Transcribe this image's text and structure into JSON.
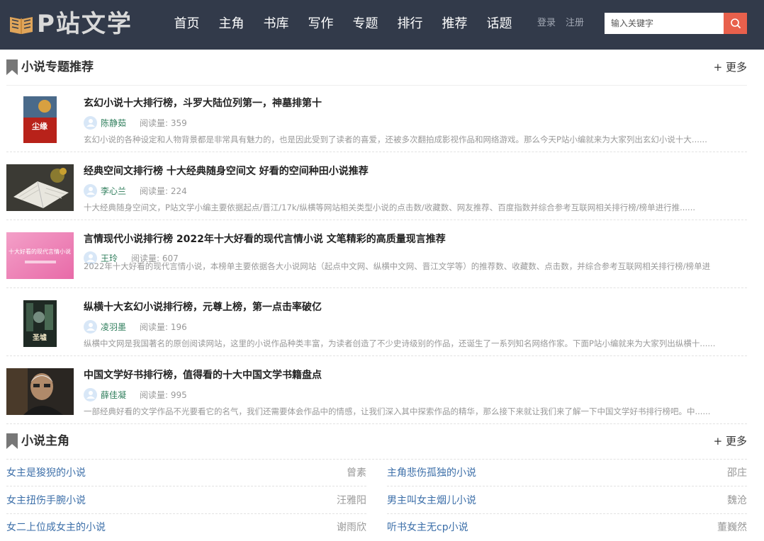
{
  "header": {
    "logo_text": "P站文学",
    "nav": [
      "首页",
      "主角",
      "书库",
      "写作",
      "专题",
      "排行",
      "推荐",
      "话题"
    ],
    "login": "登录",
    "register": "注册",
    "search_placeholder": "输入关键字"
  },
  "topics": {
    "heading": "小说专题推荐",
    "more": "+ 更多",
    "articles": [
      {
        "title": "玄幻小说十大排行榜，斗罗大陆位列第一，神墓排第十",
        "author": "陈静茹",
        "reads": "阅读量: 359",
        "excerpt": "玄幻小说的各种设定和人物背景都是非常具有魅力的，也是因此受到了读者的喜爱，还被多次翻拍成影视作品和网络游戏。那么今天P站小编就来为大家列出玄幻小说十大......",
        "thumb_text": "尘缘"
      },
      {
        "title": "经典空间文排行榜 十大经典随身空间文 好看的空间种田小说推荐",
        "author": "李心兰",
        "reads": "阅读量: 224",
        "excerpt": "十大经典随身空间文，P站文学小编主要依据起点/晋江/17k/纵横等网站相关类型小说的点击数/收藏数、网友推荐、百度指数并综合参考互联网相关排行榜/榜单进行推......"
      },
      {
        "title": "言情现代小说排行榜 2022年十大好看的现代言情小说 文笔精彩的高质量现言推荐",
        "author": "王玲",
        "reads": "阅读量: 607",
        "excerpt": "2022年十大好看的现代言情小说，本榜单主要依据各大小说网站（起点中文网、纵横中文网、晋江文学等）的推荐数、收藏数、点击数，并综合参考互联网相关排行榜/榜单进",
        "thumb_text": "十大好看的现代言情小说"
      },
      {
        "title": "纵横十大玄幻小说排行榜，元尊上榜，第一点击率破亿",
        "author": "凌羽墨",
        "reads": "阅读量: 196",
        "excerpt": "纵横中文网是我国著名的原创阅读网站，这里的小说作品种类丰富，为读者创造了不少史诗级别的作品，还诞生了一系列知名网络作家。下面P站小编就来为大家列出纵横十......",
        "thumb_text": "圣墟"
      },
      {
        "title": "中国文学好书排行榜，值得看的十大中国文学书籍盘点",
        "author": "薛佳凝",
        "reads": "阅读量: 995",
        "excerpt": "一部经典好看的文学作品不光要看它的名气，我们还需要体会作品中的情感，让我们深入其中探索作品的精华，那么接下来就让我们来了解一下中国文学好书排行榜吧。中......"
      }
    ]
  },
  "protagonists": {
    "heading": "小说主角",
    "more": "+ 更多",
    "rows": [
      [
        {
          "title": "女主是狻猊的小说",
          "author": "曾素"
        },
        {
          "title": "主角悲伤孤独的小说",
          "author": "邵庄"
        }
      ],
      [
        {
          "title": "女主扭伤手腕小说",
          "author": "汪雅阳"
        },
        {
          "title": "男主叫女主烟儿小说",
          "author": "魏沧"
        }
      ],
      [
        {
          "title": "女二上位成女主的小说",
          "author": "谢雨欣"
        },
        {
          "title": "听书女主无cp小说",
          "author": "董巍然"
        }
      ]
    ]
  },
  "colors": {
    "header_bg": "#323a4a",
    "search_button": "#e8604c",
    "author_green": "#2e7d5b",
    "link_blue": "#3b6ea8"
  }
}
